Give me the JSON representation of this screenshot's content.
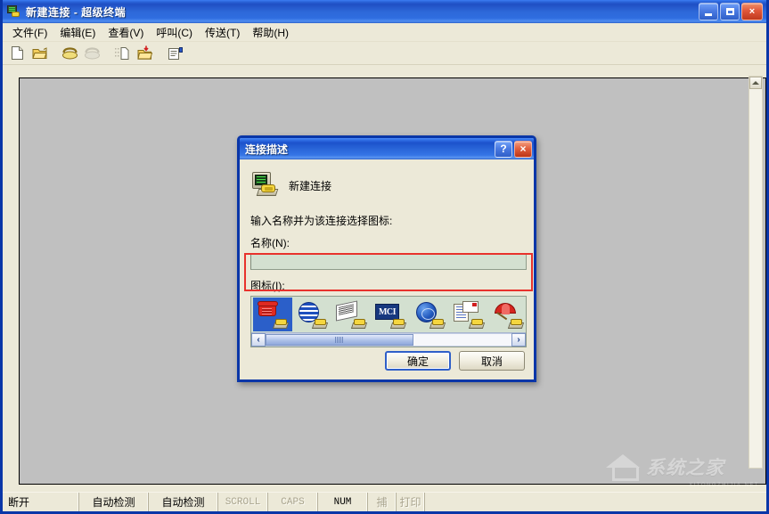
{
  "window": {
    "title": "新建连接 - 超级终端",
    "icon": "modem-connection-icon",
    "controls": {
      "minimize": "minimize-button",
      "maximize": "maximize-button",
      "close": "×"
    }
  },
  "menu": {
    "items": [
      {
        "label": "文件(F)"
      },
      {
        "label": "编辑(E)"
      },
      {
        "label": "查看(V)"
      },
      {
        "label": "呼叫(C)"
      },
      {
        "label": "传送(T)"
      },
      {
        "label": "帮助(H)"
      }
    ]
  },
  "toolbar": {
    "buttons": [
      {
        "name": "new-connection-icon",
        "enabled": true
      },
      {
        "name": "open-connection-icon",
        "enabled": true
      },
      {
        "name": "call-icon",
        "enabled": true
      },
      {
        "name": "disconnect-icon",
        "enabled": false
      },
      {
        "name": "send-file-icon",
        "enabled": true
      },
      {
        "name": "receive-file-icon",
        "enabled": true
      },
      {
        "name": "properties-icon",
        "enabled": true
      }
    ]
  },
  "terminal": {
    "content": "",
    "scrollbar": "vertical-scrollbar"
  },
  "watermark": {
    "text": "系统之家",
    "subtext": "XITONGZHIJIA.NET"
  },
  "status_bar": {
    "cells": [
      {
        "label": "断开",
        "dim": false,
        "kind": "connect"
      },
      {
        "label": "自动检测",
        "dim": false,
        "kind": "detect"
      },
      {
        "label": "自动检测",
        "dim": false,
        "kind": "detect"
      },
      {
        "label": "SCROLL",
        "dim": true,
        "kind": "ind"
      },
      {
        "label": "CAPS",
        "dim": true,
        "kind": "ind"
      },
      {
        "label": "NUM",
        "dim": false,
        "kind": "ind"
      },
      {
        "label": "捕",
        "dim": true,
        "kind": "small"
      },
      {
        "label": "打印",
        "dim": true,
        "kind": "small"
      }
    ]
  },
  "dialog": {
    "title": "连接描述",
    "help_button": "?",
    "close_button": "×",
    "header_label": "新建连接",
    "header_icon": "computer-modem-icon",
    "prompt": "输入名称并为该连接选择图标:",
    "name_label": "名称(N):",
    "name_value": "",
    "name_placeholder": "",
    "icon_label": "图标(I):",
    "icons": [
      {
        "name": "red-telephone-icon",
        "selected": true
      },
      {
        "name": "striped-globe-icon",
        "selected": false
      },
      {
        "name": "fax-papers-icon",
        "selected": false
      },
      {
        "name": "mci-logo-icon",
        "label": "MCI",
        "selected": false
      },
      {
        "name": "blue-globe-icon",
        "selected": false
      },
      {
        "name": "documents-mail-icon",
        "selected": false
      },
      {
        "name": "red-umbrella-icon",
        "selected": false
      }
    ],
    "scrollbar": {
      "left_arrow": "‹",
      "right_arrow": "›"
    },
    "ok_button": "确定",
    "cancel_button": "取消",
    "highlight_color": "#e8322c"
  },
  "colors": {
    "title_bar_blue": "#1f4fc4",
    "dialog_border_blue": "#0a36a8",
    "face": "#ece9d8",
    "terminal_bg": "#c0c0c0",
    "field_bg": "#d3e0d0",
    "selection_blue": "#2b5fc9"
  }
}
